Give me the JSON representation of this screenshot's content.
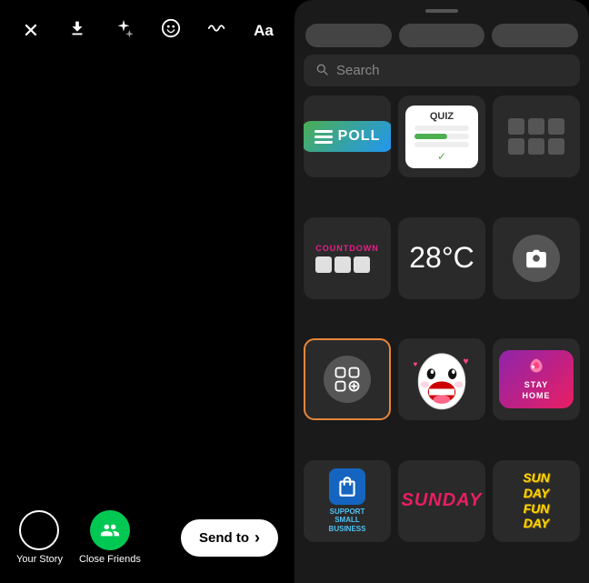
{
  "toolbar": {
    "close_label": "✕",
    "download_label": "⬇",
    "sparkle_label": "✦",
    "emoji_label": "☺",
    "wave_label": "〰",
    "text_label": "Aa"
  },
  "bottom": {
    "your_story_label": "Your Story",
    "close_friends_label": "Close Friends",
    "send_to_label": "Send to",
    "send_to_arrow": "›"
  },
  "sticker_panel": {
    "search_placeholder": "Search",
    "temp_value": "28°C",
    "sunday_text": "SUNDAY",
    "sundayfunday_text": "SUN\nDAY\nFUN\nDAY",
    "poll_label": "POLL",
    "quiz_label": "QUIZ",
    "countdown_label": "COUNTDOWN",
    "stay_home_line1": "STAY",
    "stay_home_line2": "HOME",
    "support_text": "SUPPORT\nSMALL\nBUSINESS"
  }
}
